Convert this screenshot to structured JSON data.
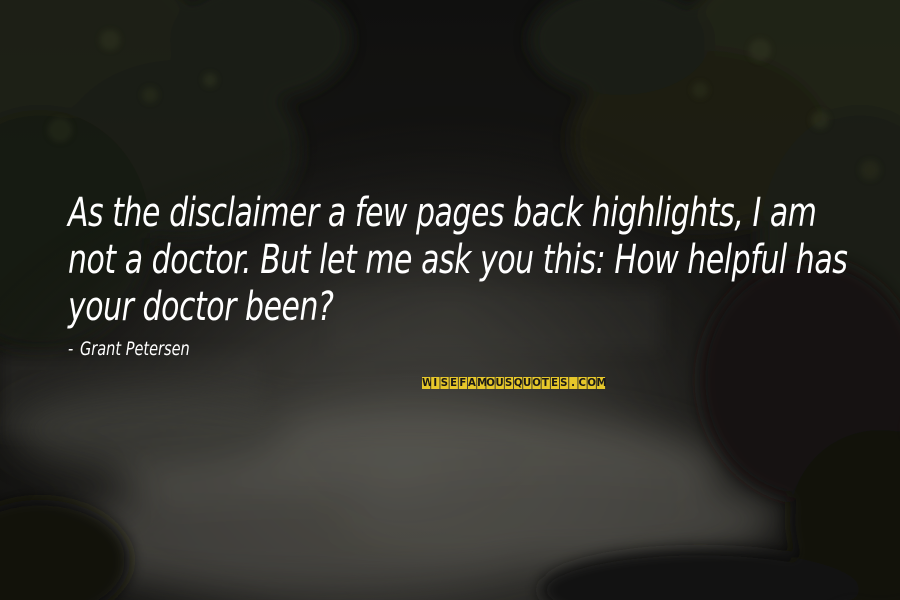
{
  "quote": {
    "lines": [
      "As the disclaimer a few pages back highlights, I am",
      "not a doctor. But let me ask you this: How helpful has",
      "your doctor been?"
    ]
  },
  "author": {
    "dash": "-",
    "name": "Grant Petersen"
  },
  "watermark": {
    "text": "WISEFAMOUSQUOTES.COM",
    "colors": {
      "tile": "#e6c72a",
      "letter": "#1b1a17"
    }
  },
  "background": {
    "scene": "dark-forest-waterfall-photo",
    "colors": {
      "sky": "#1a1a18",
      "foliage": "#2a2d1e",
      "water": "#5a5a55"
    }
  }
}
